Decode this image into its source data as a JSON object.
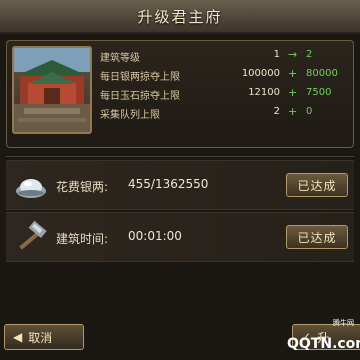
{
  "header": {
    "title": "升级君主府"
  },
  "stats": [
    {
      "label": "建筑等级",
      "current": "1",
      "op": "→",
      "next": "2"
    },
    {
      "label": "每日银两掠夺上限",
      "current": "100000",
      "op": "+",
      "next": "80000"
    },
    {
      "label": "每日玉石掠夺上限",
      "current": "12100",
      "op": "+",
      "next": "7500"
    },
    {
      "label": "采集队列上限",
      "current": "2",
      "op": "+",
      "next": "0"
    }
  ],
  "requirements": [
    {
      "label": "花费银两:",
      "value": "455/1362550",
      "status": "已达成",
      "icon": "silver-ingot-icon"
    },
    {
      "label": "建筑时间:",
      "value": "00:01:00",
      "status": "已达成",
      "icon": "hammer-icon"
    }
  ],
  "buttons": {
    "cancel": "取消",
    "confirm": "升"
  },
  "watermark": {
    "text": "QQTN.com",
    "small": "腾牛网"
  },
  "colors": {
    "accent_green": "#6fd05a",
    "gold_border": "#b39a63",
    "bg": "#1b1712"
  }
}
